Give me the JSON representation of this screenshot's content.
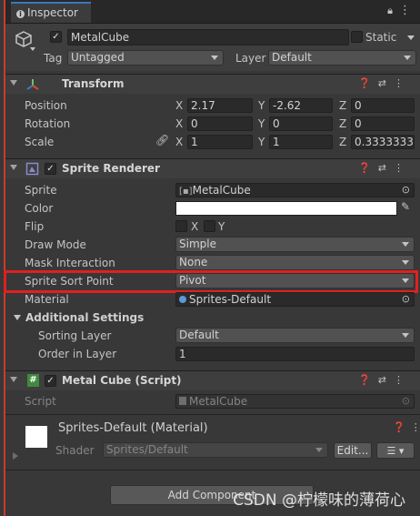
{
  "tab": {
    "title": "Inspector"
  },
  "object": {
    "name": "MetalCube",
    "static_label": "Static",
    "tag_label": "Tag",
    "tag_value": "Untagged",
    "layer_label": "Layer",
    "layer_value": "Default"
  },
  "transform": {
    "title": "Transform",
    "position_label": "Position",
    "rotation_label": "Rotation",
    "scale_label": "Scale",
    "position": {
      "x": "2.17",
      "y": "-2.62",
      "z": "0"
    },
    "rotation": {
      "x": "0",
      "y": "0",
      "z": "0"
    },
    "scale": {
      "x": "1",
      "y": "1",
      "z": "0.3333333"
    },
    "axis": {
      "x": "X",
      "y": "Y",
      "z": "Z"
    }
  },
  "sprite_renderer": {
    "title": "Sprite Renderer",
    "sprite_label": "Sprite",
    "sprite_value": "MetalCube",
    "color_label": "Color",
    "flip_label": "Flip",
    "flip_x": "X",
    "flip_y": "Y",
    "draw_mode_label": "Draw Mode",
    "draw_mode_value": "Simple",
    "mask_label": "Mask Interaction",
    "mask_value": "None",
    "sort_point_label": "Sprite Sort Point",
    "sort_point_value": "Pivot",
    "material_label": "Material",
    "material_value": "Sprites-Default",
    "additional_label": "Additional Settings",
    "sorting_layer_label": "Sorting Layer",
    "sorting_layer_value": "Default",
    "order_label": "Order in Layer",
    "order_value": "1"
  },
  "script_component": {
    "title": "Metal Cube (Script)",
    "script_label": "Script",
    "script_value": "MetalCube"
  },
  "material": {
    "title": "Sprites-Default (Material)",
    "shader_label": "Shader",
    "shader_value": "Sprites/Default",
    "edit_label": "Edit..."
  },
  "add_component": {
    "label": "Add Component"
  },
  "watermark": {
    "text": "CSDN @柠檬味的薄荷心"
  },
  "colors": {
    "highlight": "#e02020",
    "accent": "#3a79bb"
  }
}
